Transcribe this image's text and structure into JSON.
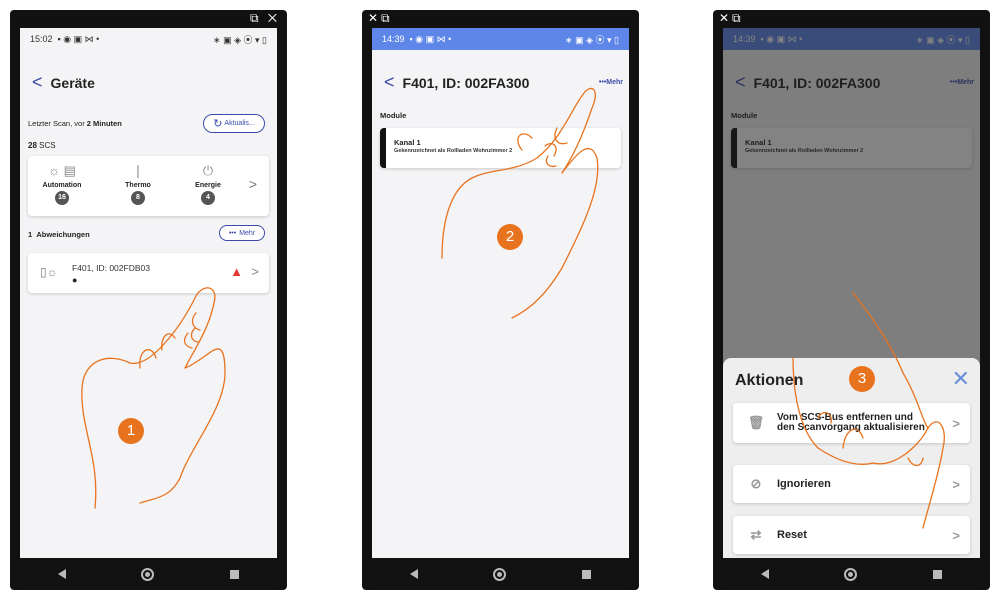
{
  "callouts": [
    "1",
    "2",
    "3"
  ],
  "corner_icons": {
    "left": "⧉ ✕",
    "mid": "✕⧉",
    "right": "✕⧉"
  },
  "phone1": {
    "status_time": "15:02",
    "status_left_icons": "▪ ◉ ▣ ⋈ •",
    "status_right_icons": "∗ ▣ ◈ ⦿ ▾ ▯",
    "title": "Geräte",
    "scan_prefix": "Letzter Scan, vor ",
    "scan_time": "2 Minuten",
    "refresh_label": "Aktualis...",
    "scs_count": "28",
    "scs_label": "SCS",
    "categories": [
      {
        "name": "Automation",
        "count": "16",
        "icon": "bulb-blinds-icon"
      },
      {
        "name": "Thermo",
        "count": "8",
        "icon": "thermometer-icon"
      },
      {
        "name": "Energie",
        "count": "4",
        "icon": "plug-icon"
      }
    ],
    "deviation_count": "1",
    "deviation_label": "Abweichungen",
    "more_label": "Mehr",
    "device_name": "F401, ID: 002FDB03"
  },
  "phone2": {
    "status_time": "14:39",
    "status_bar_color": "#5d86e8",
    "title": "F401, ID: 002FA300",
    "more_label": "Mehr",
    "section": "Module",
    "channel_title": "Kanal 1",
    "channel_sub": "Gekennzeichnet als Rollladen Wohnzimmer 2"
  },
  "phone3": {
    "sheet_title": "Aktionen",
    "actions": [
      {
        "label": "Vom SCS-Bus entfernen und den Scanvorgang aktualisieren",
        "icon": "trash-icon"
      },
      {
        "label": "Ignorieren",
        "icon": "eye-off-icon"
      },
      {
        "label": "Reset",
        "icon": "swap-arrows-icon"
      }
    ]
  },
  "colors": {
    "accent": "#3b4aa8",
    "callout": "#e8731f",
    "warning": "#e53935"
  }
}
